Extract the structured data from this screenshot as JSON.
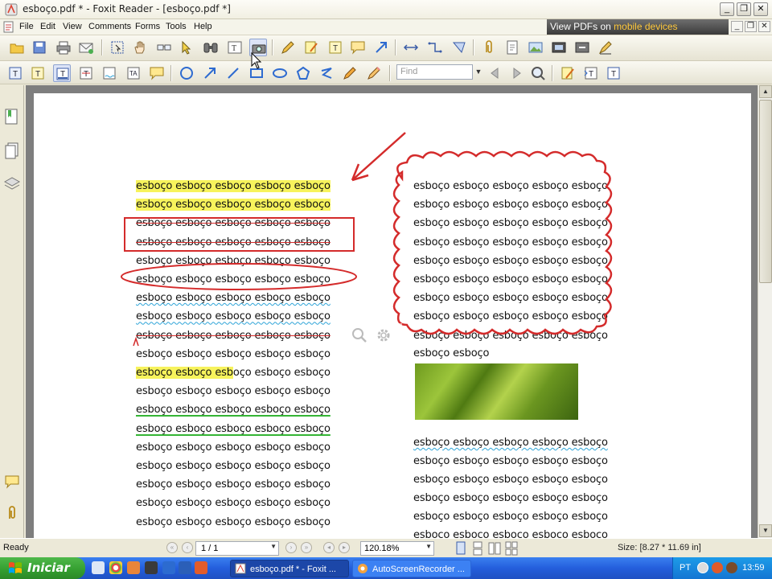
{
  "window": {
    "title": "esboço.pdf * - Foxit Reader - [esboço.pdf *]"
  },
  "menu": {
    "items": [
      "File",
      "Edit",
      "View",
      "Comments",
      "Forms",
      "Tools",
      "Help"
    ]
  },
  "promo": {
    "prefix": "View PDFs on ",
    "highlight": "mobile devices"
  },
  "toolbar": {
    "find_placeholder": "Find"
  },
  "document": {
    "left_column": [
      "esboço  esboço esboço esboço esboço",
      "esboço esboço esboço esboço esboço",
      "esboço esboço esboço esboço esboço",
      "esboço esboço esboço esboço esboço",
      "esboço esboço esboço esboço esboço",
      "esboço esboço esboço esboço esboço",
      "esboço esboço esboço esboço esboço",
      "esboço esboço esboço esboço esboço",
      "esboço esboço esboço esboço esboço",
      "esboço esboço esboço esboço esboço",
      "esboço esboço esboço esboço esboço",
      "esboço esboço esboço esboço esboço",
      "esboço esboço esboço esboço esboço",
      "esboço esboço esboço esboço esboço",
      "esboço esboço esboço esboço esboço",
      "esboço esboço esboço esboço esboço",
      "esboço esboço esboço esboço esboço",
      "esboço esboço esboço esboço esboço",
      "esboço esboço esboço esboço esboço"
    ],
    "row11_highlight": "esboço esboço esb",
    "row11_rest": "oço esboço esboço",
    "cloud_column": [
      "esboço esboço esboço esboço esboço",
      "esboço esboço esboço esboço esboço",
      "esboço esboço esboço esboço esboço",
      "esboço esboço esboço esboço esboço",
      "esboço esboço esboço esboço esboço",
      "esboço esboço esboço esboço esboço",
      "esboço esboço esboço esboço esboço",
      "esboço esboço esboço esboço esboço",
      "esboço esboço esboço esboço esboço"
    ],
    "cloud_trailing": "esboço esboço",
    "right_lower_column": [
      " esboço esboço esboço esboço esboço",
      "esboço esboço esboço esboço esboço",
      "esboço esboço esboço esboço esboço",
      "esboço esboço esboço esboço esboço",
      "esboço esboço esboço esboço esboço",
      "esboço esboço esboço esboço esboço"
    ]
  },
  "status": {
    "ready": "Ready",
    "page_value": "1 / 1",
    "zoom_value": "120.18%",
    "size": "Size: [8.27 * 11.69 in]"
  },
  "taskbar": {
    "start_label": "Iniciar",
    "tasks": [
      "esboço.pdf * - Foxit ...",
      "AutoScreenRecorder ..."
    ],
    "language": "PT",
    "clock": "13:59"
  },
  "colors": {
    "highlight": "#F7F35C",
    "annotation_red": "#D42B2B",
    "squiggle_blue": "#2EA4D8",
    "underline_green": "#35B535"
  }
}
